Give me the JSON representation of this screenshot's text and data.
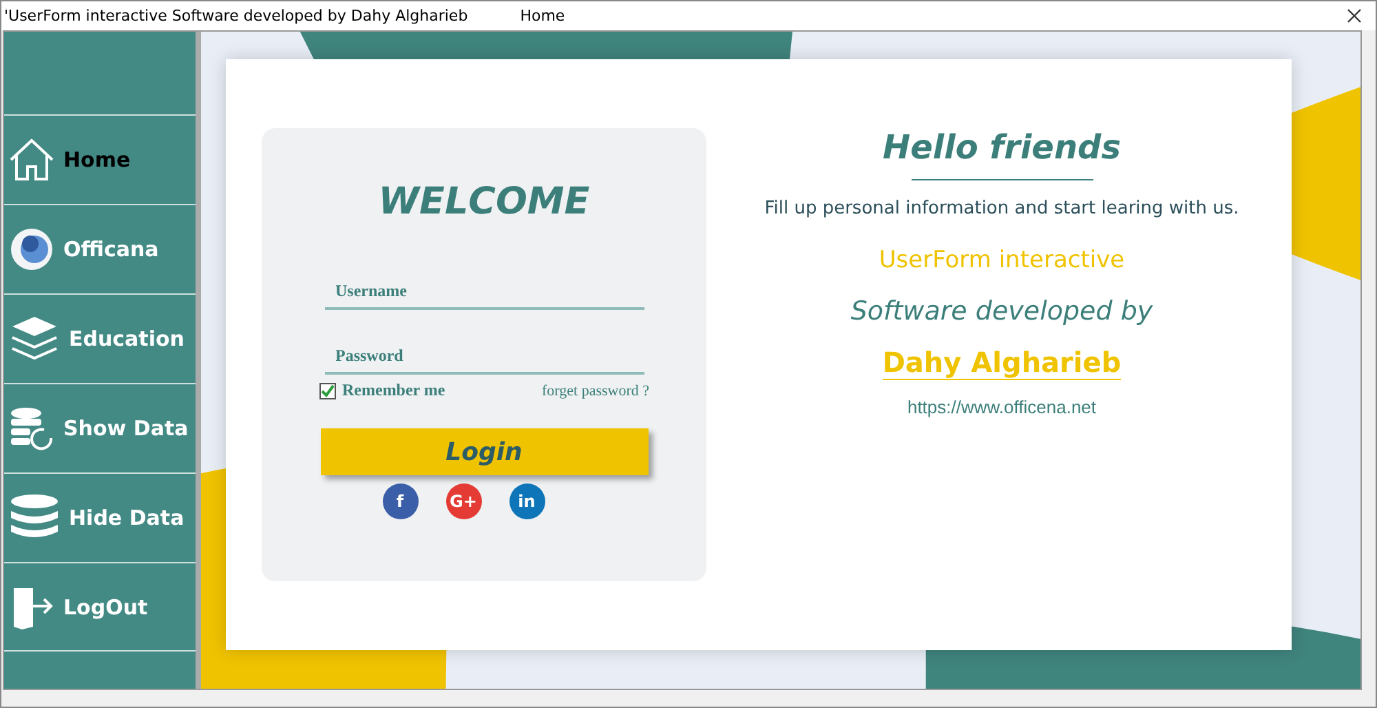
{
  "window": {
    "title": "'UserForm interactive Software developed by Dahy Algharieb",
    "caption": "Home"
  },
  "sidebar": {
    "items": [
      {
        "label": "Home",
        "kind": "house",
        "selected": true
      },
      {
        "label": "Officana",
        "kind": "logo",
        "selected": false
      },
      {
        "label": "Education",
        "kind": "layers",
        "selected": false
      },
      {
        "label": "Show Data",
        "kind": "database-refresh",
        "selected": false
      },
      {
        "label": "Hide Data",
        "kind": "database",
        "selected": false
      },
      {
        "label": "LogOut",
        "kind": "exit",
        "selected": false
      }
    ]
  },
  "login": {
    "heading": "WELCOME",
    "username": {
      "placeholder": "Username"
    },
    "password": {
      "placeholder": "Password"
    },
    "remember": {
      "label": "Remember me",
      "checked": true
    },
    "forgot": "forget password ?",
    "button": "Login",
    "social": [
      {
        "label": "f",
        "color": "#3b5ea8"
      },
      {
        "label": "G+",
        "color": "#e53b35"
      },
      {
        "label": "in",
        "color": "#0e76b8"
      }
    ]
  },
  "info": {
    "title": "Hello friends",
    "subtitle": "Fill up personal information and start learing with us.",
    "product": "UserForm interactive",
    "developed": "Software developed by",
    "author": "Dahy Algharieb",
    "url": "https://www.officena.net"
  }
}
